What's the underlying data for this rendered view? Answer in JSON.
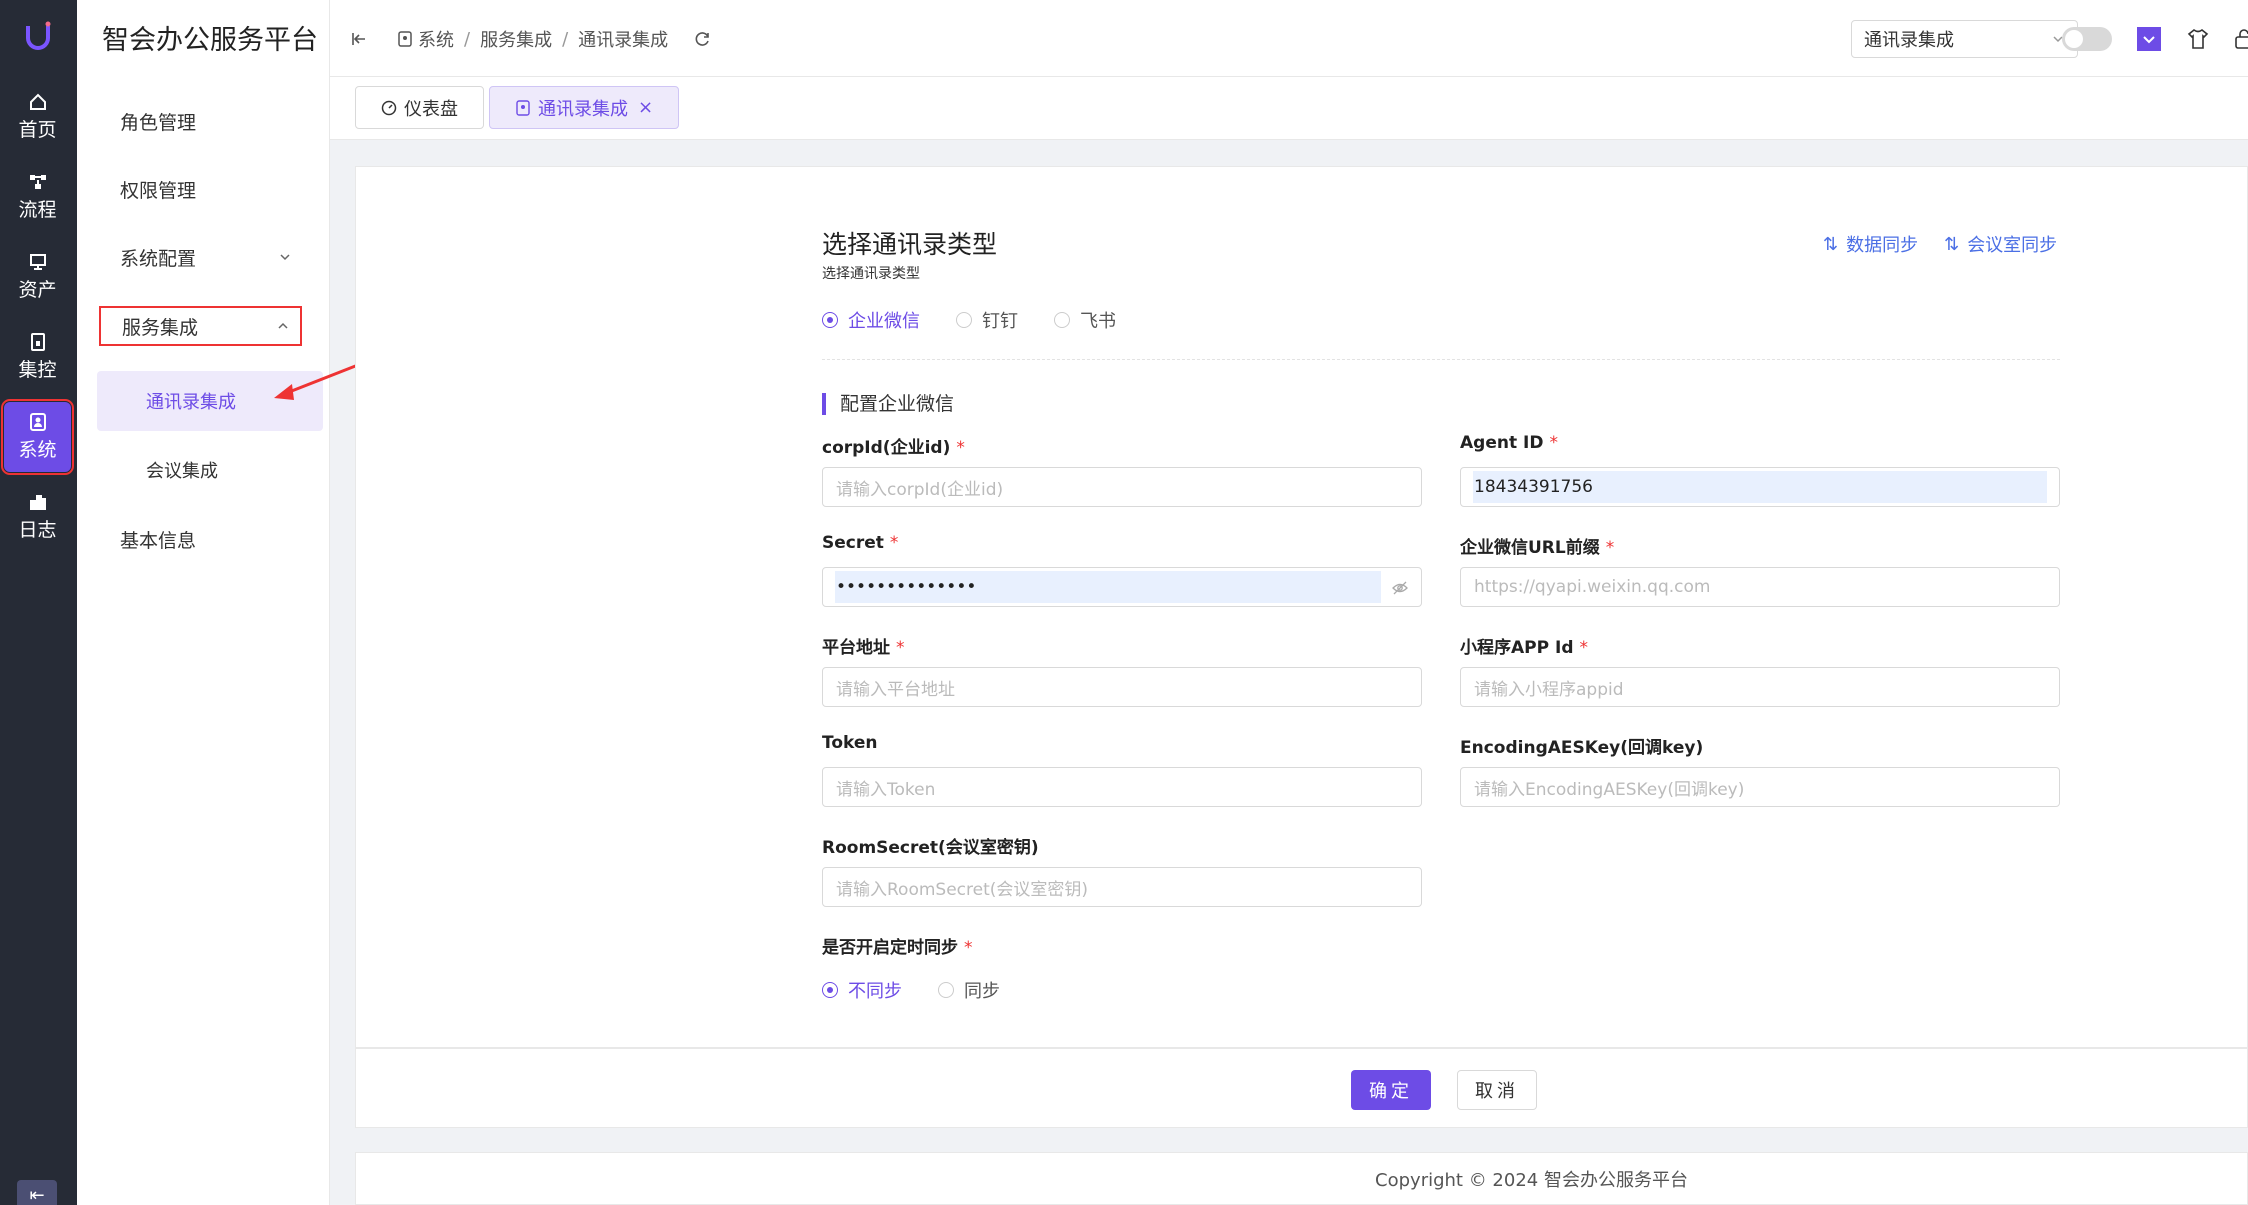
{
  "app": {
    "title": "智会办公服务平台"
  },
  "rail": {
    "items": [
      {
        "label": "首页",
        "icon": "home-icon"
      },
      {
        "label": "流程",
        "icon": "flow-icon"
      },
      {
        "label": "资产",
        "icon": "asset-icon"
      },
      {
        "label": "集控",
        "icon": "control-icon"
      },
      {
        "label": "系统",
        "icon": "system-icon",
        "active": true
      },
      {
        "label": "日志",
        "icon": "log-icon"
      }
    ],
    "collapse_glyph": "⇤"
  },
  "sidebar": {
    "items": [
      {
        "label": "角色管理"
      },
      {
        "label": "权限管理"
      },
      {
        "label": "系统配置"
      },
      {
        "label": "服务集成"
      },
      {
        "label": "通讯录集成"
      },
      {
        "label": "会议集成"
      },
      {
        "label": "基本信息"
      }
    ]
  },
  "breadcrumb": {
    "items": [
      "系统",
      "服务集成",
      "通讯录集成"
    ],
    "separator": "/"
  },
  "topbar": {
    "select_value": "通讯录集成"
  },
  "tabs": [
    {
      "label": "仪表盘"
    },
    {
      "label": "通讯录集成",
      "close": "×"
    }
  ],
  "form": {
    "title": "选择通讯录类型",
    "subtitle": "选择通讯录类型",
    "sync_buttons": [
      {
        "label": "数据同步",
        "glyph": "⇅"
      },
      {
        "label": "会议室同步",
        "glyph": "⇅"
      }
    ],
    "types": [
      {
        "label": "企业微信",
        "selected": true
      },
      {
        "label": "钉钉",
        "selected": false
      },
      {
        "label": "飞书",
        "selected": false
      }
    ],
    "section_title": "配置企业微信",
    "fields": {
      "corpid": {
        "label": "corpId(企业id)",
        "placeholder": "请输入corpId(企业id)",
        "required": true
      },
      "agentid": {
        "label": "Agent ID",
        "value": "18434391756",
        "required": true
      },
      "secret": {
        "label": "Secret",
        "value": "••••••••••••••",
        "required": true
      },
      "urlprefix": {
        "label": "企业微信URL前缀",
        "placeholder": "https://qyapi.weixin.qq.com",
        "required": true
      },
      "platform": {
        "label": "平台地址",
        "placeholder": "请输入平台地址",
        "required": true
      },
      "appid": {
        "label": "小程序APP Id",
        "placeholder": "请输入小程序appid",
        "required": true
      },
      "token": {
        "label": "Token",
        "placeholder": "请输入Token",
        "required": false
      },
      "aeskey": {
        "label": "EncodingAESKey(回调key)",
        "placeholder": "请输入EncodingAESKey(回调key)",
        "required": false
      },
      "roomsecret": {
        "label": "RoomSecret(会议室密钥)",
        "placeholder": "请输入RoomSecret(会议室密钥)",
        "required": false
      }
    },
    "timer_sync": {
      "label": "是否开启定时同步",
      "options": [
        {
          "label": "不同步",
          "selected": true
        },
        {
          "label": "同步",
          "selected": false
        }
      ]
    },
    "required_mark": "*"
  },
  "buttons": {
    "confirm": "确定",
    "cancel": "取消"
  },
  "footer": {
    "copyright": "Copyright © 2024 智会办公服务平台"
  },
  "colors": {
    "accent": "#6d4ce6",
    "rail_bg": "#262b36",
    "link": "#4b6fe5",
    "highlight_box": "#ee3333"
  }
}
